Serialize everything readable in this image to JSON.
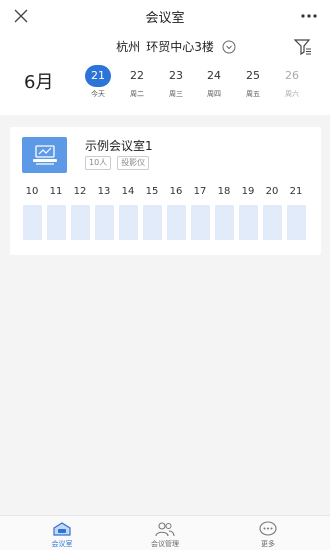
{
  "header": {
    "title": "会议室",
    "close_icon": "close-icon",
    "more_icon": "more-icon"
  },
  "location": {
    "city": "杭州",
    "building": "环贸中心3楼",
    "dropdown_icon": "chevron-down-circle-icon",
    "filter_icon": "filter-icon"
  },
  "calendar": {
    "month": "6月",
    "days": [
      {
        "num": "21",
        "label": "今天",
        "selected": true
      },
      {
        "num": "22",
        "label": "周二"
      },
      {
        "num": "23",
        "label": "周三"
      },
      {
        "num": "24",
        "label": "周四"
      },
      {
        "num": "25",
        "label": "周五"
      },
      {
        "num": "26",
        "label": "周六",
        "disabled": true
      }
    ]
  },
  "room": {
    "name": "示例会议室1",
    "tags": [
      "10人",
      "投影仪"
    ],
    "hours": [
      "10",
      "11",
      "12",
      "13",
      "14",
      "15",
      "16",
      "17",
      "18",
      "19",
      "20",
      "21"
    ]
  },
  "tabs": [
    {
      "label": "会议室",
      "icon": "meeting-room-icon",
      "active": true
    },
    {
      "label": "会议管理",
      "icon": "users-icon"
    },
    {
      "label": "更多",
      "icon": "more-chat-icon"
    }
  ],
  "colors": {
    "accent": "#2d74d8",
    "slot": "#e2ebf9",
    "room_thumb": "#5c9ae8"
  }
}
